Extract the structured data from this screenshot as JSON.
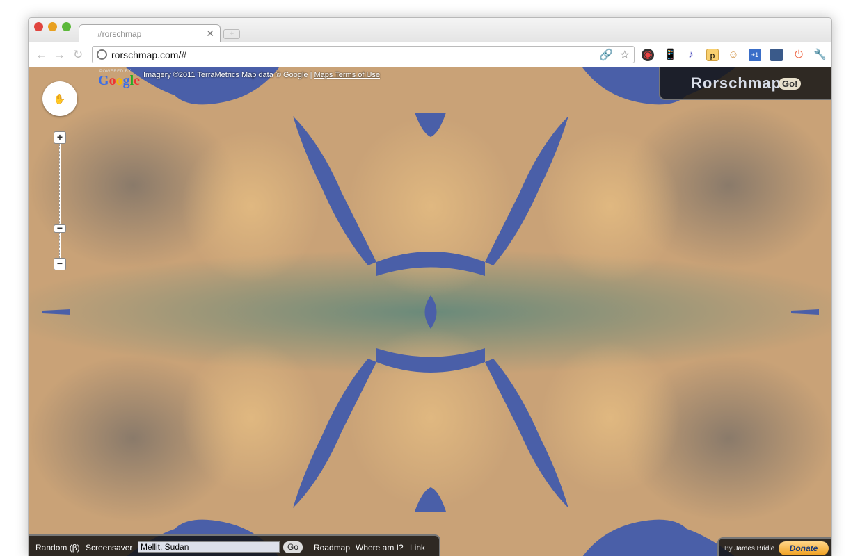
{
  "browser": {
    "tab_title": "#rorschmap",
    "url": "rorschmap.com/#",
    "extensions": [
      "link-icon",
      "star-icon",
      "camera-icon",
      "phone-icon",
      "music-icon",
      "p-icon",
      "face-icon",
      "plus-one-icon",
      "window-icon",
      "power-icon",
      "wrench-icon"
    ]
  },
  "map": {
    "attribution": "Imagery ©2011 TerraMetrics Map data © Google |",
    "terms_link": "Maps Terms of Use",
    "logo": "Google",
    "powered": "POWERED BY",
    "colors": {
      "land": "#c9a277",
      "water": "#4a5fa8",
      "green": "#5a7a5a"
    }
  },
  "brand": {
    "title": "Rorschmap",
    "go": "Go!"
  },
  "bottom": {
    "random": "Random (β)",
    "screensaver": "Screensaver",
    "location_value": "Mellit, Sudan",
    "go": "Go",
    "roadmap": "Roadmap",
    "where": "Where am I?",
    "link": "Link"
  },
  "credit": {
    "by": "By",
    "author": "James Bridle",
    "donate": "Donate"
  }
}
